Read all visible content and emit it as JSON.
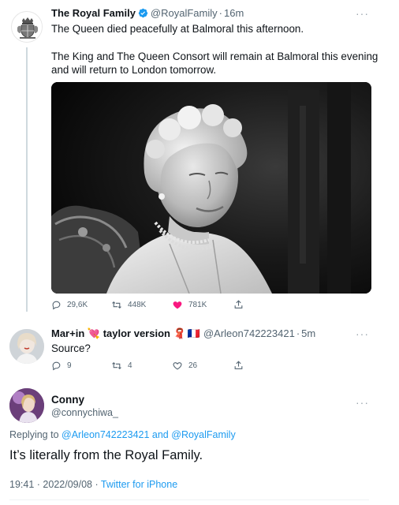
{
  "tweet1": {
    "name": "The Royal Family",
    "handle": "@RoyalFamily",
    "dot": "·",
    "time": "16m",
    "more": "···",
    "line1": "The Queen died peacefully at Balmoral this afternoon.",
    "line2": "The King and The Queen Consort will remain at Balmoral this evening",
    "line3": "and will return to London tomorrow.",
    "replies": "29,6K",
    "retweets": "448K",
    "likes": "781K",
    "liked": true,
    "verified": true
  },
  "tweet2": {
    "name_part1": "Mar+in",
    "emoji1": "💘",
    "name_part2": "taylor version",
    "emoji2": "🧣",
    "flag": "🇫🇷",
    "handle": "@Arleon742223421",
    "dot": "·",
    "time": "5m",
    "more": "···",
    "text": "Source?",
    "replies": "9",
    "retweets": "4",
    "likes": "26"
  },
  "tweet3": {
    "name": "Conny",
    "handle": "@connychiwa_",
    "more": "···",
    "replying_prefix": "Replying to",
    "replying_user1": "@Arleon742223421",
    "replying_and": "and",
    "replying_user2": "@RoyalFamily",
    "text": "It’s literally from the Royal Family.",
    "time": "19:41",
    "dot": "·",
    "date": "2022/09/08",
    "dot2": "·",
    "source": "Twitter for iPhone"
  },
  "colors": {
    "link": "#1d9bf0",
    "like": "#f91880",
    "muted": "#536471",
    "verified": "#1d9bf0"
  }
}
